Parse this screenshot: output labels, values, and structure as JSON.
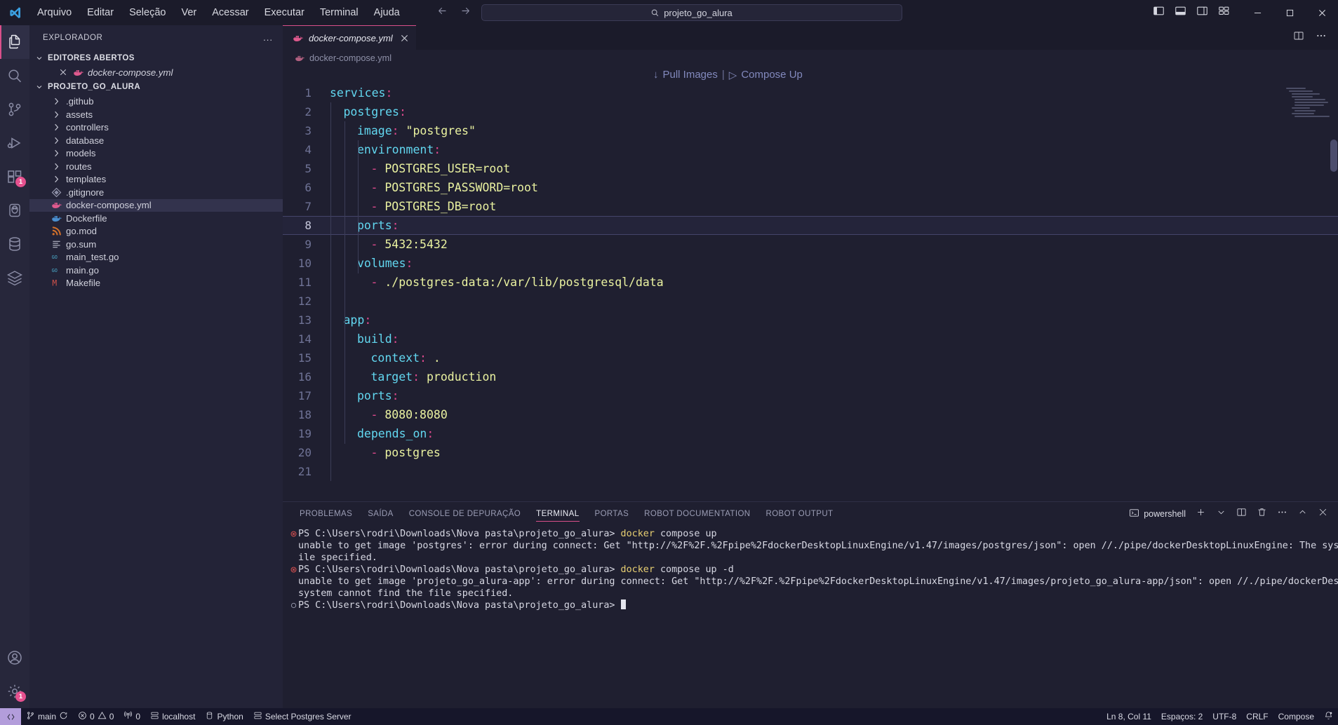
{
  "titlebar": {
    "menu": [
      "Arquivo",
      "Editar",
      "Seleção",
      "Ver",
      "Acessar",
      "Executar",
      "Terminal",
      "Ajuda"
    ],
    "search_value": "projeto_go_alura",
    "search_icon": "search-icon",
    "back_icon": "arrow-left-icon",
    "forward_icon": "arrow-right-icon",
    "layout_icons": [
      "toggle-primary-sidebar-icon",
      "toggle-panel-icon",
      "toggle-secondary-sidebar-icon",
      "customize-layout-icon"
    ],
    "window_controls": [
      "minimize-icon",
      "maximize-icon",
      "close-icon"
    ]
  },
  "activitybar": {
    "items": [
      {
        "name": "explorer-icon",
        "badge": ""
      },
      {
        "name": "search-icon",
        "badge": ""
      },
      {
        "name": "source-control-icon",
        "badge": ""
      },
      {
        "name": "run-and-debug-icon",
        "badge": ""
      },
      {
        "name": "extensions-icon",
        "badge": "1"
      },
      {
        "name": "postgresql-icon",
        "badge": ""
      },
      {
        "name": "database-icon",
        "badge": ""
      },
      {
        "name": "layers-icon",
        "badge": ""
      }
    ],
    "bottom_items": [
      {
        "name": "accounts-icon",
        "badge": ""
      },
      {
        "name": "settings-gear-icon",
        "badge": "1"
      }
    ]
  },
  "sidebar": {
    "title": "EXPLORADOR",
    "more_label": "...",
    "open_editors": {
      "label": "EDITORES ABERTOS",
      "items": [
        {
          "label": "docker-compose.yml",
          "icon": "docker-icon"
        }
      ]
    },
    "project": {
      "label": "PROJETO_GO_ALURA",
      "items": [
        {
          "label": ".github",
          "icon": "folder-chevron-icon",
          "type": "folder"
        },
        {
          "label": "assets",
          "icon": "folder-chevron-icon",
          "type": "folder"
        },
        {
          "label": "controllers",
          "icon": "folder-chevron-icon",
          "type": "folder"
        },
        {
          "label": "database",
          "icon": "folder-chevron-icon",
          "type": "folder"
        },
        {
          "label": "models",
          "icon": "folder-chevron-icon",
          "type": "folder"
        },
        {
          "label": "routes",
          "icon": "folder-chevron-icon",
          "type": "folder"
        },
        {
          "label": "templates",
          "icon": "folder-chevron-icon",
          "type": "folder"
        },
        {
          "label": ".gitignore",
          "icon": "git-icon",
          "type": "file"
        },
        {
          "label": "docker-compose.yml",
          "icon": "docker-icon",
          "type": "file",
          "selected": true
        },
        {
          "label": "Dockerfile",
          "icon": "docker-blue-icon",
          "type": "file"
        },
        {
          "label": "go.mod",
          "icon": "gomod-icon",
          "type": "file"
        },
        {
          "label": "go.sum",
          "icon": "gosum-icon",
          "type": "file"
        },
        {
          "label": "main_test.go",
          "icon": "go-icon",
          "type": "file"
        },
        {
          "label": "main.go",
          "icon": "go-icon",
          "type": "file"
        },
        {
          "label": "Makefile",
          "icon": "makefile-icon",
          "type": "file"
        }
      ]
    }
  },
  "editor": {
    "tab": {
      "label": "docker-compose.yml",
      "icon": "docker-icon",
      "close_icon": "close-icon"
    },
    "tab_actions": [
      "split-editor-icon",
      "more-actions-icon"
    ],
    "breadcrumb": {
      "label": "docker-compose.yml",
      "icon": "docker-icon"
    },
    "codelens": {
      "pull": "Pull Images",
      "separator": "|",
      "up": "Compose Up",
      "pull_icon": "download-arrow-icon",
      "up_icon": "play-triangle-icon"
    },
    "current_line": 8,
    "lines": [
      {
        "n": 1,
        "indent": 0,
        "parts": [
          {
            "t": "services",
            "c": "k"
          },
          {
            "t": ":",
            "c": "p"
          }
        ]
      },
      {
        "n": 2,
        "indent": 1,
        "parts": [
          {
            "t": "postgres",
            "c": "k"
          },
          {
            "t": ":",
            "c": "p"
          }
        ]
      },
      {
        "n": 3,
        "indent": 2,
        "parts": [
          {
            "t": "image",
            "c": "k"
          },
          {
            "t": ":",
            "c": "p"
          },
          {
            "t": " ",
            "c": ""
          },
          {
            "t": "\"postgres\"",
            "c": "s"
          }
        ]
      },
      {
        "n": 4,
        "indent": 2,
        "parts": [
          {
            "t": "environment",
            "c": "k"
          },
          {
            "t": ":",
            "c": "p"
          }
        ]
      },
      {
        "n": 5,
        "indent": 3,
        "parts": [
          {
            "t": "- ",
            "c": "d"
          },
          {
            "t": "POSTGRES_USER=root",
            "c": "s"
          }
        ]
      },
      {
        "n": 6,
        "indent": 3,
        "parts": [
          {
            "t": "- ",
            "c": "d"
          },
          {
            "t": "POSTGRES_PASSWORD=root",
            "c": "s"
          }
        ]
      },
      {
        "n": 7,
        "indent": 3,
        "parts": [
          {
            "t": "- ",
            "c": "d"
          },
          {
            "t": "POSTGRES_DB=root",
            "c": "s"
          }
        ]
      },
      {
        "n": 8,
        "indent": 2,
        "parts": [
          {
            "t": "ports",
            "c": "k"
          },
          {
            "t": ":",
            "c": "p"
          }
        ]
      },
      {
        "n": 9,
        "indent": 3,
        "parts": [
          {
            "t": "- ",
            "c": "d"
          },
          {
            "t": "5432:5432",
            "c": "s"
          }
        ]
      },
      {
        "n": 10,
        "indent": 2,
        "parts": [
          {
            "t": "volumes",
            "c": "k"
          },
          {
            "t": ":",
            "c": "p"
          }
        ]
      },
      {
        "n": 11,
        "indent": 3,
        "parts": [
          {
            "t": "- ",
            "c": "d"
          },
          {
            "t": "./postgres-data:/var/lib/postgresql/data",
            "c": "s"
          }
        ]
      },
      {
        "n": 12,
        "indent": 0,
        "parts": []
      },
      {
        "n": 13,
        "indent": 1,
        "parts": [
          {
            "t": "app",
            "c": "k"
          },
          {
            "t": ":",
            "c": "p"
          }
        ]
      },
      {
        "n": 14,
        "indent": 2,
        "parts": [
          {
            "t": "build",
            "c": "k"
          },
          {
            "t": ":",
            "c": "p"
          }
        ]
      },
      {
        "n": 15,
        "indent": 3,
        "parts": [
          {
            "t": "context",
            "c": "k"
          },
          {
            "t": ":",
            "c": "p"
          },
          {
            "t": " ",
            "c": ""
          },
          {
            "t": ".",
            "c": "s"
          }
        ]
      },
      {
        "n": 16,
        "indent": 3,
        "parts": [
          {
            "t": "target",
            "c": "k"
          },
          {
            "t": ":",
            "c": "p"
          },
          {
            "t": " ",
            "c": ""
          },
          {
            "t": "production",
            "c": "s"
          }
        ]
      },
      {
        "n": 17,
        "indent": 2,
        "parts": [
          {
            "t": "ports",
            "c": "k"
          },
          {
            "t": ":",
            "c": "p"
          }
        ]
      },
      {
        "n": 18,
        "indent": 3,
        "parts": [
          {
            "t": "- ",
            "c": "d"
          },
          {
            "t": "8080:8080",
            "c": "s"
          }
        ]
      },
      {
        "n": 19,
        "indent": 2,
        "parts": [
          {
            "t": "depends_on",
            "c": "k"
          },
          {
            "t": ":",
            "c": "p"
          }
        ]
      },
      {
        "n": 20,
        "indent": 3,
        "parts": [
          {
            "t": "- ",
            "c": "d"
          },
          {
            "t": "postgres",
            "c": "s"
          }
        ]
      },
      {
        "n": 21,
        "indent": 0,
        "parts": []
      }
    ]
  },
  "panel": {
    "tabs": [
      {
        "label": "PROBLEMAS",
        "active": false
      },
      {
        "label": "SAÍDA",
        "active": false
      },
      {
        "label": "CONSOLE DE DEPURAÇÃO",
        "active": false
      },
      {
        "label": "TERMINAL",
        "active": true
      },
      {
        "label": "PORTAS",
        "active": false
      },
      {
        "label": "ROBOT DOCUMENTATION",
        "active": false
      },
      {
        "label": "ROBOT OUTPUT",
        "active": false
      }
    ],
    "shell": "powershell",
    "shell_icon": "terminal-icon",
    "actions": [
      "add-terminal-icon",
      "chevron-down-icon",
      "split-terminal-icon",
      "trash-icon",
      "more-actions-icon",
      "chevron-up-icon",
      "close-icon"
    ],
    "terminal_lines": [
      {
        "mark": "error",
        "segments": [
          {
            "t": "PS C:\\Users\\rodri\\Downloads\\Nova pasta\\projeto_go_alura> ",
            "c": "t-prompt"
          },
          {
            "t": "docker",
            "c": "t-cmd"
          },
          {
            "t": " compose up",
            "c": "t-prompt"
          }
        ]
      },
      {
        "mark": "",
        "segments": [
          {
            "t": "unable to get image 'postgres': error during connect: Get \"http://%2F%2F.%2Fpipe%2FdockerDesktopLinuxEngine/v1.47/images/postgres/json\": open //./pipe/dockerDesktopLinuxEngine: The system cannot find the f",
            "c": "t-err"
          }
        ]
      },
      {
        "mark": "",
        "segments": [
          {
            "t": "ile specified.",
            "c": "t-err"
          }
        ]
      },
      {
        "mark": "error",
        "segments": [
          {
            "t": "PS C:\\Users\\rodri\\Downloads\\Nova pasta\\projeto_go_alura> ",
            "c": "t-prompt"
          },
          {
            "t": "docker",
            "c": "t-cmd"
          },
          {
            "t": " compose up -d",
            "c": "t-prompt"
          }
        ]
      },
      {
        "mark": "",
        "segments": [
          {
            "t": "unable to get image 'projeto_go_alura-app': error during connect: Get \"http://%2F%2F.%2Fpipe%2FdockerDesktopLinuxEngine/v1.47/images/projeto_go_alura-app/json\": open //./pipe/dockerDesktopLinuxEngine: The",
            "c": "t-err"
          }
        ]
      },
      {
        "mark": "",
        "segments": [
          {
            "t": "system cannot find the file specified.",
            "c": "t-err"
          }
        ]
      },
      {
        "mark": "ok",
        "segments": [
          {
            "t": "PS C:\\Users\\rodri\\Downloads\\Nova pasta\\projeto_go_alura> ",
            "c": "t-prompt"
          }
        ],
        "cursor": true
      }
    ]
  },
  "statusbar": {
    "remote_icon": "remote-window-icon",
    "left": [
      {
        "label": "main",
        "icon": "source-control-branch-icon",
        "icon2": "sync-icon"
      },
      {
        "label": "0",
        "icon": "error-icon",
        "label2": "0",
        "icon2": "warning-icon"
      },
      {
        "label": "0",
        "icon": "radio-tower-icon"
      },
      {
        "label": "localhost",
        "icon": "server-icon"
      },
      {
        "label": "Python",
        "icon": "database-small-icon"
      },
      {
        "label": "Select Postgres Server",
        "icon": "server-icon"
      }
    ],
    "right": [
      {
        "label": "Ln 8, Col 11"
      },
      {
        "label": "Espaços: 2"
      },
      {
        "label": "UTF-8"
      },
      {
        "label": "CRLF"
      },
      {
        "label": "Compose"
      },
      {
        "label": "",
        "icon": "bell-dot-icon"
      }
    ]
  },
  "colors": {
    "accent": "#d94f8a",
    "editor_bg": "#1f1f30",
    "sidebar_bg": "#232337",
    "titlebar_bg": "#1b1b2a",
    "statusbar_bg": "#16162a",
    "badge": "#e6518f"
  }
}
